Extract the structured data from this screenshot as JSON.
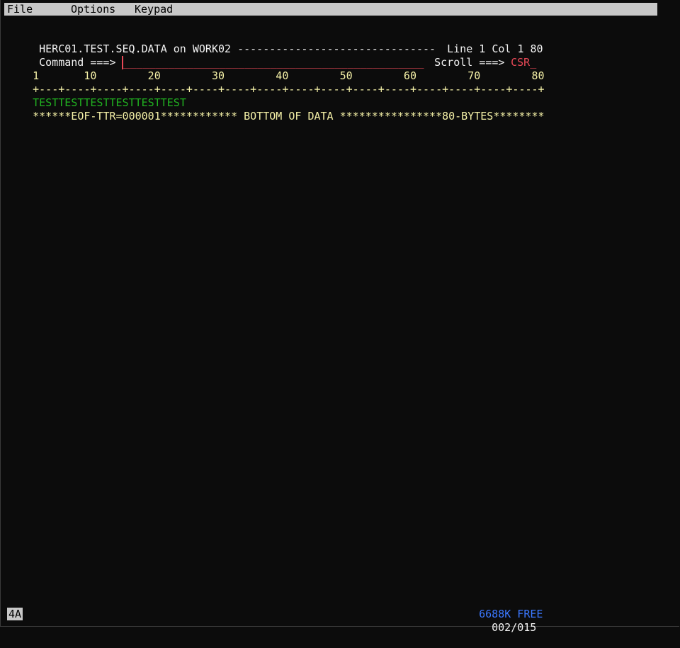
{
  "menu": {
    "file": "File",
    "options": "Options",
    "keypad": "Keypad"
  },
  "header": {
    "dataset": "HERC01.TEST.SEQ.DATA on WORK02 -------------------------------",
    "position": "Line 1 Col 1 80"
  },
  "command": {
    "label": "Command ===>",
    "value": "_______________________________________________",
    "scroll_label": "Scroll ===>",
    "scroll_value": "CSR_"
  },
  "ruler": {
    "numbers": "1       10        20        30        40        50        60        70        80",
    "marks": "+---+----+----+----+----+----+----+----+----+----+----+----+----+----+----+----+"
  },
  "data": {
    "lines": [
      "TESTTESTTESTTESTTESTTEST"
    ],
    "bottom": "******EOF-TTR=000001************ BOTTOM OF DATA ****************80-BYTES********"
  },
  "status": {
    "free": "6688K FREE",
    "page": "002/015",
    "mode": "4A"
  },
  "colors": {
    "background": "#0c0c0c",
    "text": "#f2f2f2",
    "ruler": "#f6f2a8",
    "data": "#21b321",
    "input": "#e74856",
    "info": "#3b78ff"
  }
}
